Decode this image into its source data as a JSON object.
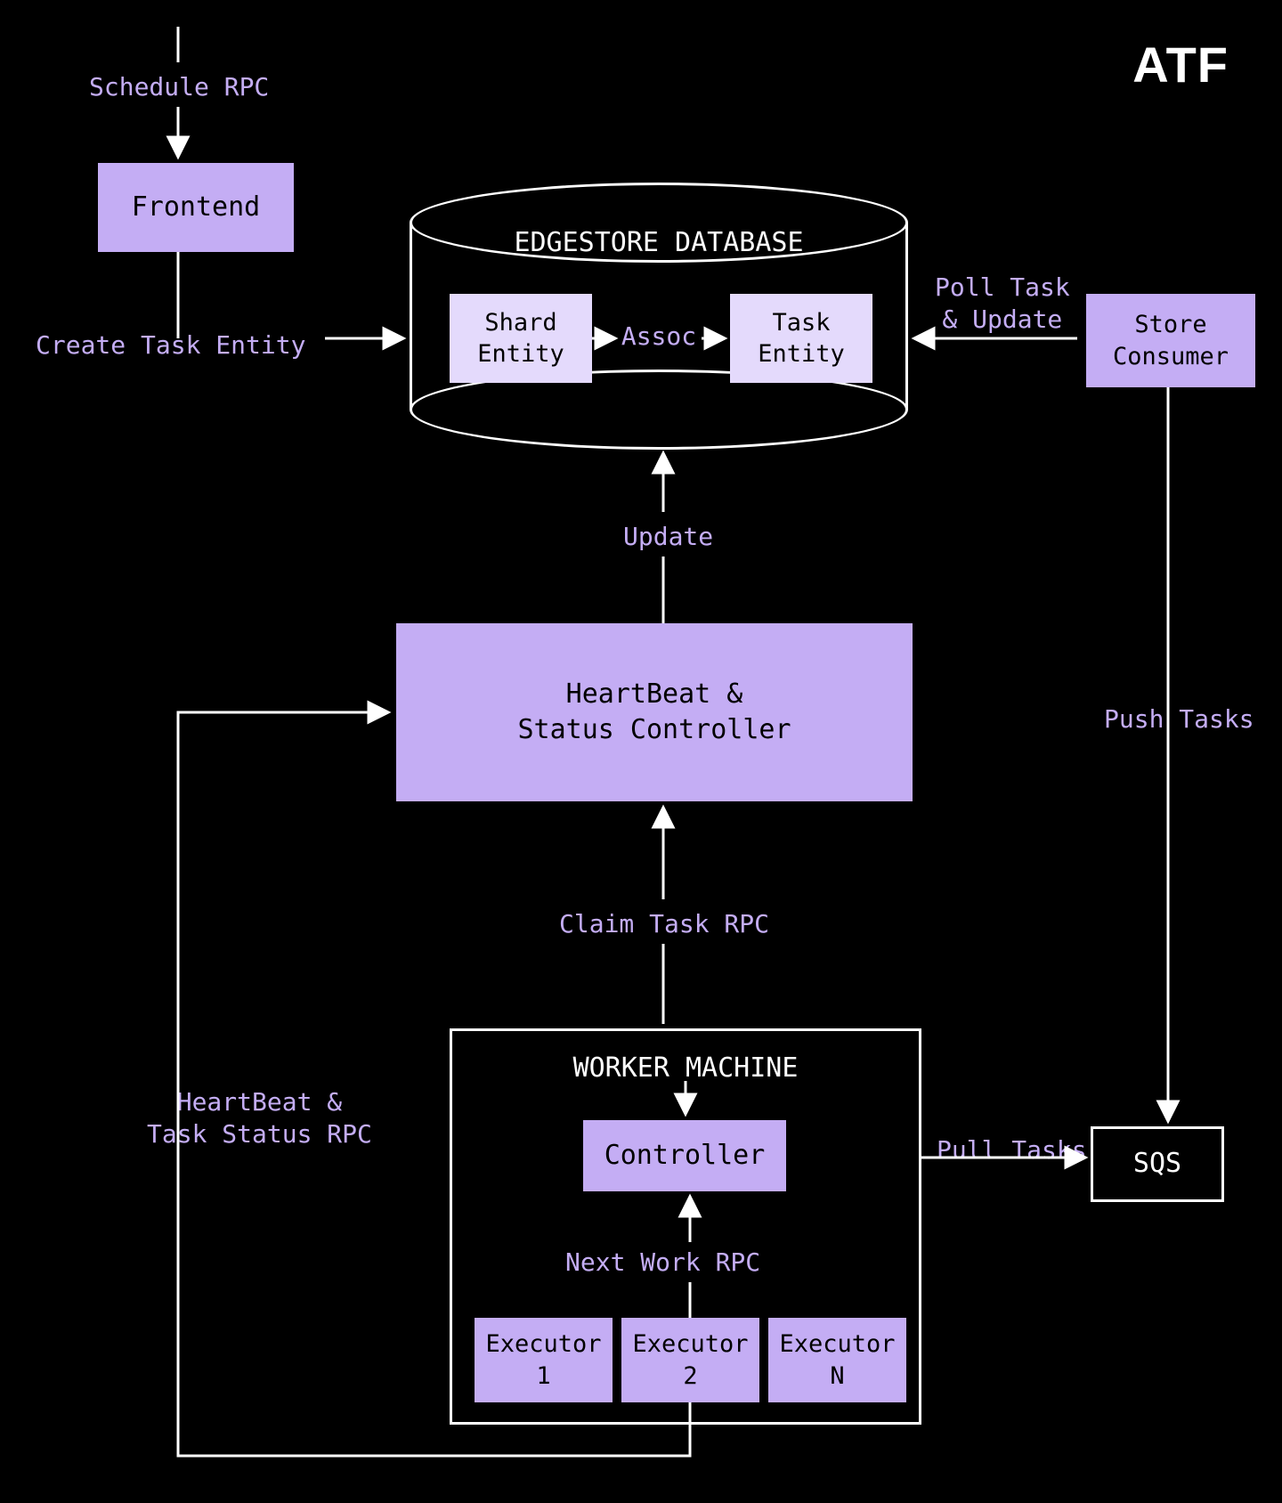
{
  "logo": "ATF",
  "nodes": {
    "frontend": "Frontend",
    "database_title": "EDGESTORE DATABASE",
    "shard_entity": "Shard\nEntity",
    "task_entity": "Task\nEntity",
    "assoc": "Assoc",
    "store_consumer": "Store\nConsumer",
    "heartbeat_controller": "HeartBeat &\nStatus Controller",
    "worker_machine_title": "WORKER MACHINE",
    "controller": "Controller",
    "executor1": "Executor\n1",
    "executor2": "Executor\n2",
    "executorN": "Executor\nN",
    "sqs": "SQS"
  },
  "edges": {
    "schedule_rpc": "Schedule RPC",
    "create_task_entity": "Create Task Entity",
    "poll_task_update": "Poll Task\n& Update",
    "update": "Update",
    "push_tasks": "Push Tasks",
    "claim_task_rpc": "Claim Task RPC",
    "heartbeat_status_rpc": "HeartBeat &\nTask Status RPC",
    "next_work_rpc": "Next Work RPC",
    "pull_tasks": "Pull Tasks"
  }
}
